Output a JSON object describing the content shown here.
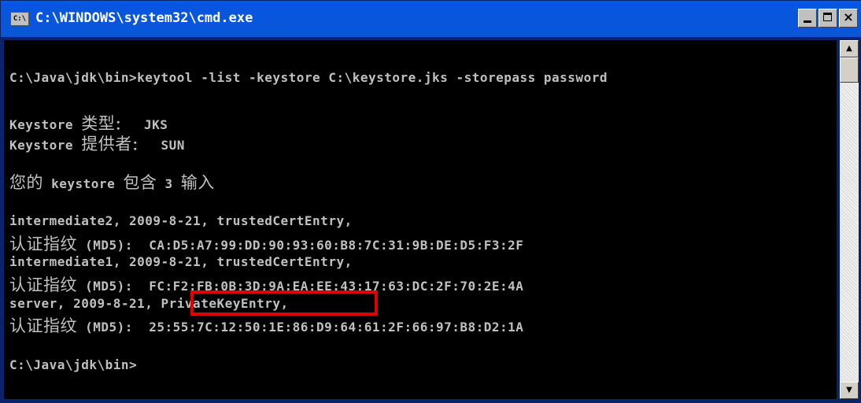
{
  "window": {
    "icon_text": "C:\\",
    "title": "C:\\WINDOWS\\system32\\cmd.exe",
    "controls": {
      "minimize": "",
      "maximize": "",
      "close": "×"
    }
  },
  "console": {
    "lines": [
      {
        "parts": [
          "C:\\Java\\jdk\\bin>keytool -list -keystore C:\\keystore.jks -storepass password"
        ]
      },
      {
        "parts": [
          "Keystore ",
          "类型",
          "：  JKS"
        ]
      },
      {
        "parts": [
          "Keystore ",
          "提供者",
          "：  SUN"
        ]
      },
      {
        "parts": [
          "您的",
          " keystore ",
          "包含",
          " 3 ",
          "输入"
        ]
      },
      {
        "parts": [
          "intermediate2, 2009-8-21, trustedCertEntry,"
        ]
      },
      {
        "parts": [
          "认证指纹",
          " (MD5):  CA:D5:A7:99:DD:90:93:60:B8:7C:31:9B:DE:D5:F3:2F"
        ]
      },
      {
        "parts": [
          "intermediate1, 2009-8-21, trustedCertEntry,"
        ]
      },
      {
        "parts": [
          "认证指纹",
          " (MD5):  FC:F2:FB:0B:3D:9A:EA:EE:43:17:63:DC:2F:70:2E:4A"
        ]
      },
      {
        "parts": [
          "server, 2009-8-21, PrivateKeyEntry,"
        ]
      },
      {
        "parts": [
          "认证指纹",
          " (MD5):  25:55:7C:12:50:1E:86:D9:64:61:2F:66:97:B8:D2:1A"
        ]
      },
      {
        "parts": [
          "C:\\Java\\jdk\\bin>"
        ]
      }
    ]
  },
  "highlight": {
    "color": "#e00000"
  },
  "scrollbar": {
    "up_arrow": "▲",
    "down_arrow": "▼"
  }
}
